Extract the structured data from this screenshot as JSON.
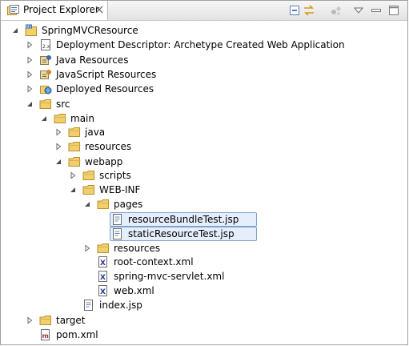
{
  "view": {
    "tab_title": "Project Explorer",
    "tab_icon": "project-explorer-icon",
    "toolbar": [
      "collapse-all-icon",
      "link-with-editor-icon",
      "focus-icon",
      "view-menu-icon",
      "minimize-icon",
      "maximize-icon"
    ]
  },
  "tree": [
    {
      "label": "SpringMVCResource",
      "icon": "project-icon",
      "expanded": true
    },
    {
      "label": "Deployment Descriptor: Archetype Created Web Application",
      "icon": "deployment-descriptor-icon",
      "expanded": false
    },
    {
      "label": "Java Resources",
      "icon": "java-resources-icon",
      "expanded": false
    },
    {
      "label": "JavaScript Resources",
      "icon": "javascript-resources-icon",
      "expanded": false
    },
    {
      "label": "Deployed Resources",
      "icon": "deployed-resources-icon",
      "expanded": false
    },
    {
      "label": "src",
      "icon": "folder-icon",
      "expanded": true
    },
    {
      "label": "main",
      "icon": "folder-icon",
      "expanded": true
    },
    {
      "label": "java",
      "icon": "folder-icon",
      "expanded": false
    },
    {
      "label": "resources",
      "icon": "folder-icon",
      "expanded": false
    },
    {
      "label": "webapp",
      "icon": "folder-icon",
      "expanded": true
    },
    {
      "label": "scripts",
      "icon": "folder-icon",
      "expanded": false
    },
    {
      "label": "WEB-INF",
      "icon": "folder-icon",
      "expanded": true
    },
    {
      "label": "pages",
      "icon": "folder-icon",
      "expanded": true
    },
    {
      "label": "resourceBundleTest.jsp",
      "icon": "jsp-file-icon",
      "selected": true
    },
    {
      "label": "staticResourceTest.jsp",
      "icon": "jsp-file-icon",
      "selected": true
    },
    {
      "label": "resources",
      "icon": "folder-icon",
      "expanded": false
    },
    {
      "label": "root-context.xml",
      "icon": "xml-file-icon"
    },
    {
      "label": "spring-mvc-servlet.xml",
      "icon": "xml-file-icon"
    },
    {
      "label": "web.xml",
      "icon": "xml-file-icon"
    },
    {
      "label": "index.jsp",
      "icon": "jsp-file-icon"
    },
    {
      "label": "target",
      "icon": "folder-icon",
      "expanded": false
    },
    {
      "label": "pom.xml",
      "icon": "maven-pom-icon"
    }
  ],
  "colors": {
    "selection_fill": "#e5eefb",
    "selection_border": "#7da2ce",
    "folder": "#e8c061"
  }
}
